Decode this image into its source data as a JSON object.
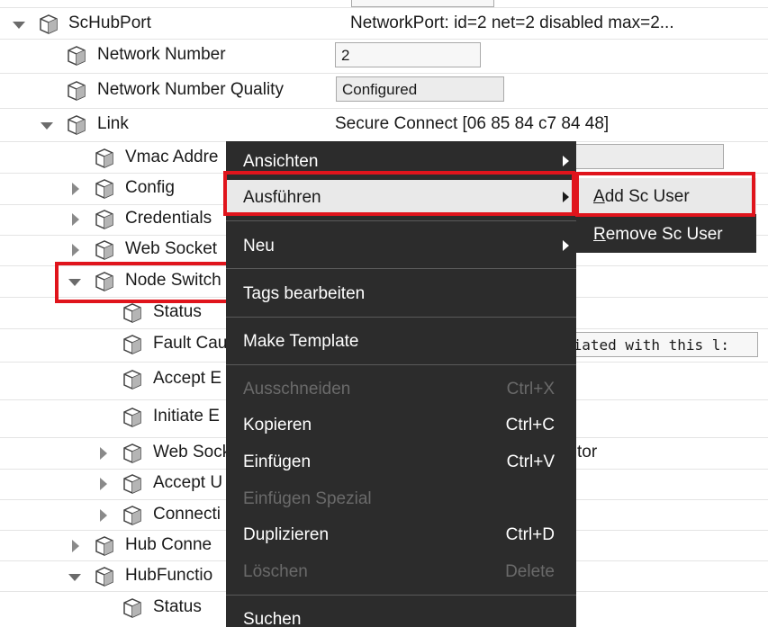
{
  "tree": {
    "schubport": {
      "label": "ScHubPort",
      "value": "NetworkPort: id=2 net=2 disabled max=2..."
    },
    "network_number": {
      "label": "Network Number",
      "value": "2"
    },
    "network_number_quality": {
      "label": "Network Number Quality",
      "value": "Configured"
    },
    "link": {
      "label": "Link",
      "value": "Secure Connect [06 85 84 c7 84 48]"
    },
    "vmac": {
      "label": "Vmac Addre"
    },
    "config": {
      "label": "Config"
    },
    "credentials": {
      "label": "Credentials"
    },
    "web_socket": {
      "label": "Web Socket"
    },
    "node_switch": {
      "label": "Node Switch"
    },
    "status": {
      "label": "Status"
    },
    "fault_cause": {
      "label": "Fault Cau",
      "value": "ciated with this l:"
    },
    "accept_e": {
      "label": "Accept E"
    },
    "initiate_e": {
      "label": "Initiate E"
    },
    "web_sock": {
      "label": "Web Sock",
      "value": "tor"
    },
    "accept_u": {
      "label": "Accept U"
    },
    "connecti": {
      "label": "Connecti"
    },
    "hub_conne": {
      "label": "Hub Conne"
    },
    "hub_function": {
      "label": "HubFunctio"
    },
    "status2": {
      "label": "Status"
    }
  },
  "menu": {
    "ansichten": "Ansichten",
    "ausfuehren": "Ausführen",
    "neu": "Neu",
    "tags": "Tags bearbeiten",
    "template": "Make Template",
    "ausschneiden": "Ausschneiden",
    "ausschneiden_key": "Ctrl+X",
    "kopieren": "Kopieren",
    "kopieren_key": "Ctrl+C",
    "einfuegen": "Einfügen",
    "einfuegen_key": "Ctrl+V",
    "einfuegen_spezial": "Einfügen Spezial",
    "duplizieren": "Duplizieren",
    "duplizieren_key": "Ctrl+D",
    "loeschen": "Löschen",
    "loeschen_key": "Delete",
    "suchen": "Suchen"
  },
  "submenu": {
    "add_first": "A",
    "add_rest": "dd Sc User",
    "remove_first": "R",
    "remove_rest": "emove Sc User"
  },
  "colors": {
    "highlight": "#e0141c",
    "menu_bg": "#2c2c2c",
    "menu_active": "#e9e9e9"
  }
}
